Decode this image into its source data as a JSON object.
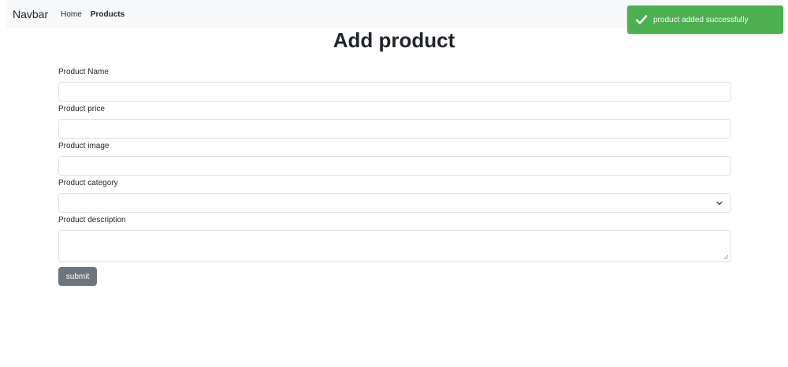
{
  "navbar": {
    "brand": "Navbar",
    "links": [
      {
        "label": "Home",
        "active": false
      },
      {
        "label": "Products",
        "active": true
      }
    ]
  },
  "toast": {
    "message": "product added successfully",
    "icon": "check-icon",
    "color": "#4caf50"
  },
  "page": {
    "title": "Add product"
  },
  "form": {
    "fields": [
      {
        "label": "Product Name",
        "value": "",
        "type": "text"
      },
      {
        "label": "Product price",
        "value": "",
        "type": "text"
      },
      {
        "label": "Product image",
        "value": "",
        "type": "text"
      },
      {
        "label": "Product category",
        "value": "",
        "type": "select"
      },
      {
        "label": "Product description",
        "value": "",
        "type": "textarea"
      }
    ],
    "submit_label": "submit"
  }
}
